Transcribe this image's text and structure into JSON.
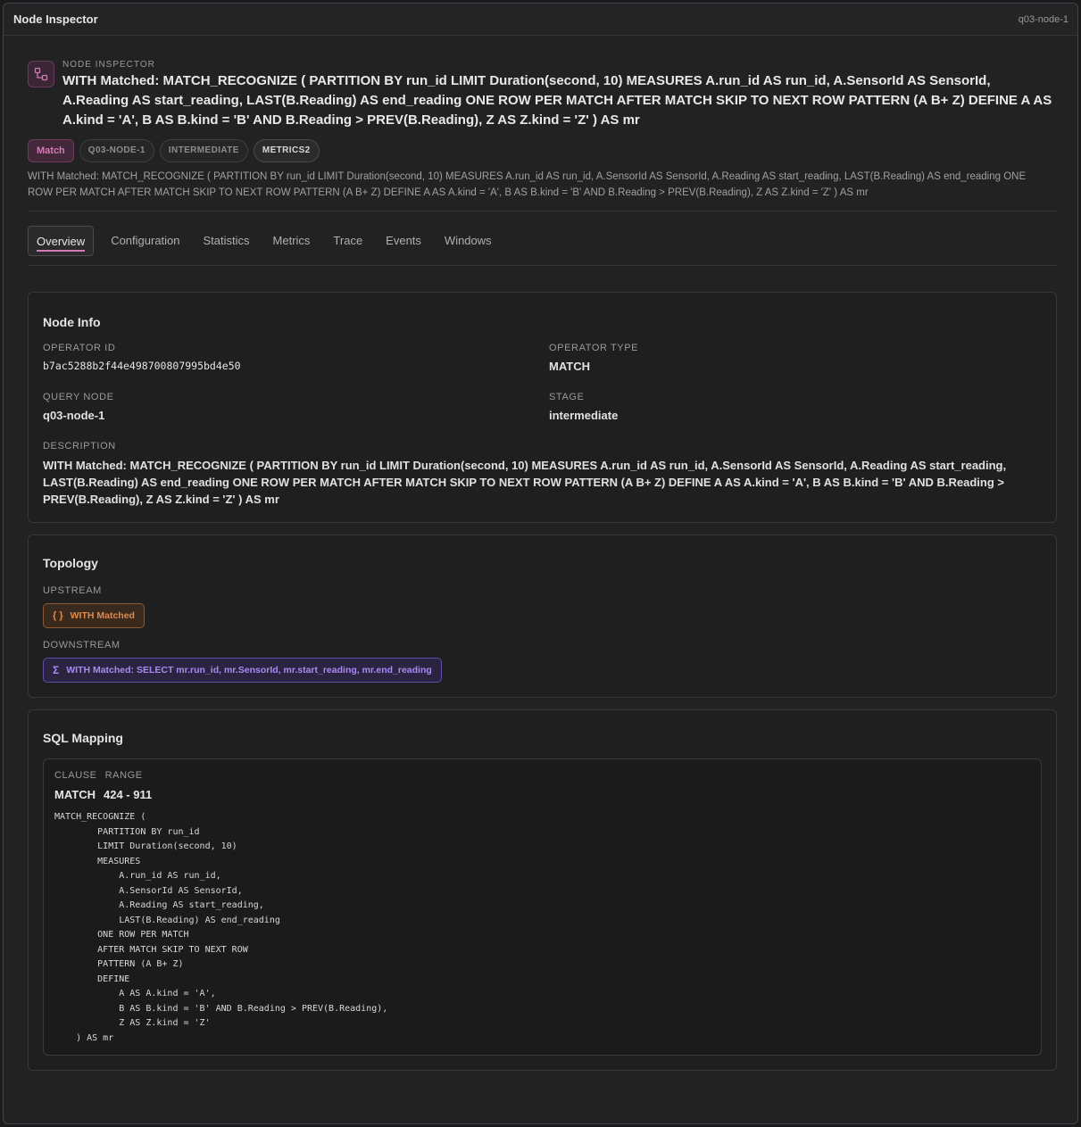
{
  "window": {
    "title": "Node Inspector",
    "node_id": "q03-node-1"
  },
  "header": {
    "eyebrow": "NODE INSPECTOR",
    "title": "WITH Matched: MATCH_RECOGNIZE ( PARTITION BY run_id LIMIT Duration(second, 10) MEASURES A.run_id AS run_id, A.SensorId AS SensorId, A.Reading AS start_reading, LAST(B.Reading) AS end_reading ONE ROW PER MATCH AFTER MATCH SKIP TO NEXT ROW PATTERN (A B+ Z) DEFINE A AS A.kind = 'A', B AS B.kind = 'B' AND B.Reading > PREV(B.Reading), Z AS Z.kind = 'Z' ) AS mr",
    "badges": [
      "Match",
      "Q03-NODE-1",
      "INTERMEDIATE",
      "METRICS2"
    ],
    "description": "WITH Matched: MATCH_RECOGNIZE ( PARTITION BY run_id LIMIT Duration(second, 10) MEASURES A.run_id AS run_id, A.SensorId AS SensorId, A.Reading AS start_reading, LAST(B.Reading) AS end_reading ONE ROW PER MATCH AFTER MATCH SKIP TO NEXT ROW PATTERN (A B+ Z) DEFINE A AS A.kind = 'A', B AS B.kind = 'B' AND B.Reading > PREV(B.Reading), Z AS Z.kind = 'Z' ) AS mr",
    "accent_color": "#d47bb5"
  },
  "tabs": [
    "Overview",
    "Configuration",
    "Statistics",
    "Metrics",
    "Trace",
    "Events",
    "Windows"
  ],
  "active_tab": "Overview",
  "node_info": {
    "title": "Node Info",
    "operator_id_label": "OPERATOR ID",
    "operator_id": "b7ac5288b2f44e498700807995bd4e50",
    "operator_type_label": "OPERATOR TYPE",
    "operator_type": "MATCH",
    "query_node_label": "QUERY NODE",
    "query_node": "q03-node-1",
    "stage_label": "STAGE",
    "stage": "intermediate",
    "description_label": "DESCRIPTION",
    "description": "WITH Matched: MATCH_RECOGNIZE ( PARTITION BY run_id LIMIT Duration(second, 10) MEASURES A.run_id AS run_id, A.SensorId AS SensorId, A.Reading AS start_reading, LAST(B.Reading) AS end_reading ONE ROW PER MATCH AFTER MATCH SKIP TO NEXT ROW PATTERN (A B+ Z) DEFINE A AS A.kind = 'A', B AS B.kind = 'B' AND B.Reading > PREV(B.Reading), Z AS Z.kind = 'Z' ) AS mr"
  },
  "topology": {
    "title": "Topology",
    "upstream_label": "UPSTREAM",
    "upstream": {
      "icon": "braces-icon",
      "glyph": "{ }",
      "label": "WITH Matched",
      "color": "#e0894a"
    },
    "downstream_label": "DOWNSTREAM",
    "downstream": {
      "icon": "sigma-icon",
      "glyph": "Σ",
      "label": "WITH Matched: SELECT mr.run_id, mr.SensorId, mr.start_reading, mr.end_reading",
      "color": "#a88af0"
    }
  },
  "sql_mapping": {
    "title": "SQL Mapping",
    "clause_label": "CLAUSE",
    "range_label": "RANGE",
    "clause": "MATCH",
    "range": "424 - 911",
    "code": "MATCH_RECOGNIZE (\n        PARTITION BY run_id\n        LIMIT Duration(second, 10)\n        MEASURES\n            A.run_id AS run_id,\n            A.SensorId AS SensorId,\n            A.Reading AS start_reading,\n            LAST(B.Reading) AS end_reading\n        ONE ROW PER MATCH\n        AFTER MATCH SKIP TO NEXT ROW\n        PATTERN (A B+ Z)\n        DEFINE\n            A AS A.kind = 'A',\n            B AS B.kind = 'B' AND B.Reading > PREV(B.Reading),\n            Z AS Z.kind = 'Z'\n    ) AS mr"
  }
}
